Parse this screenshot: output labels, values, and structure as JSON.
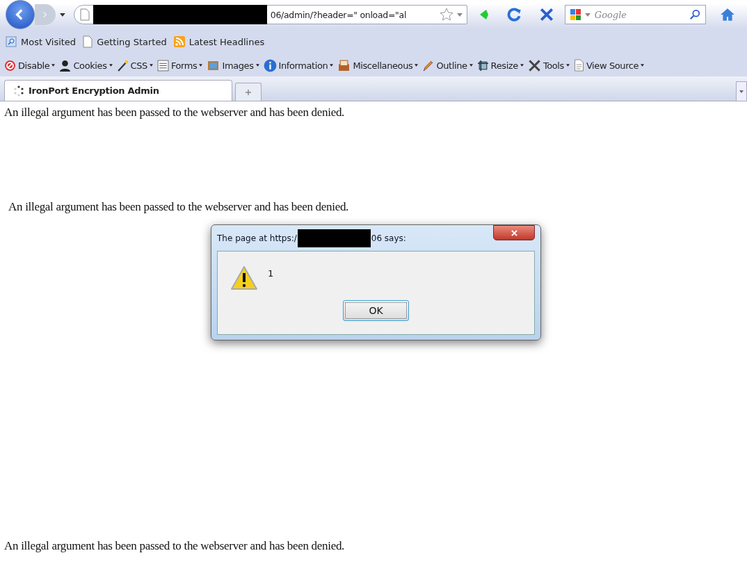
{
  "toolbar": {
    "url": {
      "value": "06/admin/?header=\" onload=\"al"
    },
    "search": {
      "placeholder": "Google"
    }
  },
  "bookmarks": [
    {
      "label": "Most Visited",
      "kind": "smart"
    },
    {
      "label": "Getting Started",
      "kind": "page"
    },
    {
      "label": "Latest Headlines",
      "kind": "feed"
    }
  ],
  "dev_toolbar": [
    {
      "label": "Disable",
      "kind": "disable"
    },
    {
      "label": "Cookies",
      "kind": "cookies"
    },
    {
      "label": "CSS",
      "kind": "css"
    },
    {
      "label": "Forms",
      "kind": "forms"
    },
    {
      "label": "Images",
      "kind": "images"
    },
    {
      "label": "Information",
      "kind": "information"
    },
    {
      "label": "Miscellaneous",
      "kind": "misc"
    },
    {
      "label": "Outline",
      "kind": "outline"
    },
    {
      "label": "Resize",
      "kind": "resize"
    },
    {
      "label": "Tools",
      "kind": "tools"
    },
    {
      "label": "View Source",
      "kind": "source"
    }
  ],
  "tabs": [
    {
      "label": "IronPort Encryption Admin",
      "selected": true
    }
  ],
  "page": {
    "messages": [
      {
        "text": "An illegal argument has been passed to the webserver and has been denied.",
        "kind": "plain"
      },
      {
        "text": "An illegal argument has been passed to the webserver and has been denied.",
        "kind": "indented"
      },
      {
        "text": "An illegal argument has been passed to the webserver and has been denied.",
        "kind": "bottom"
      }
    ]
  },
  "dialog": {
    "title_start": "The page at https:/",
    "title_end": "06 says:",
    "message": "1",
    "button": "OK"
  }
}
